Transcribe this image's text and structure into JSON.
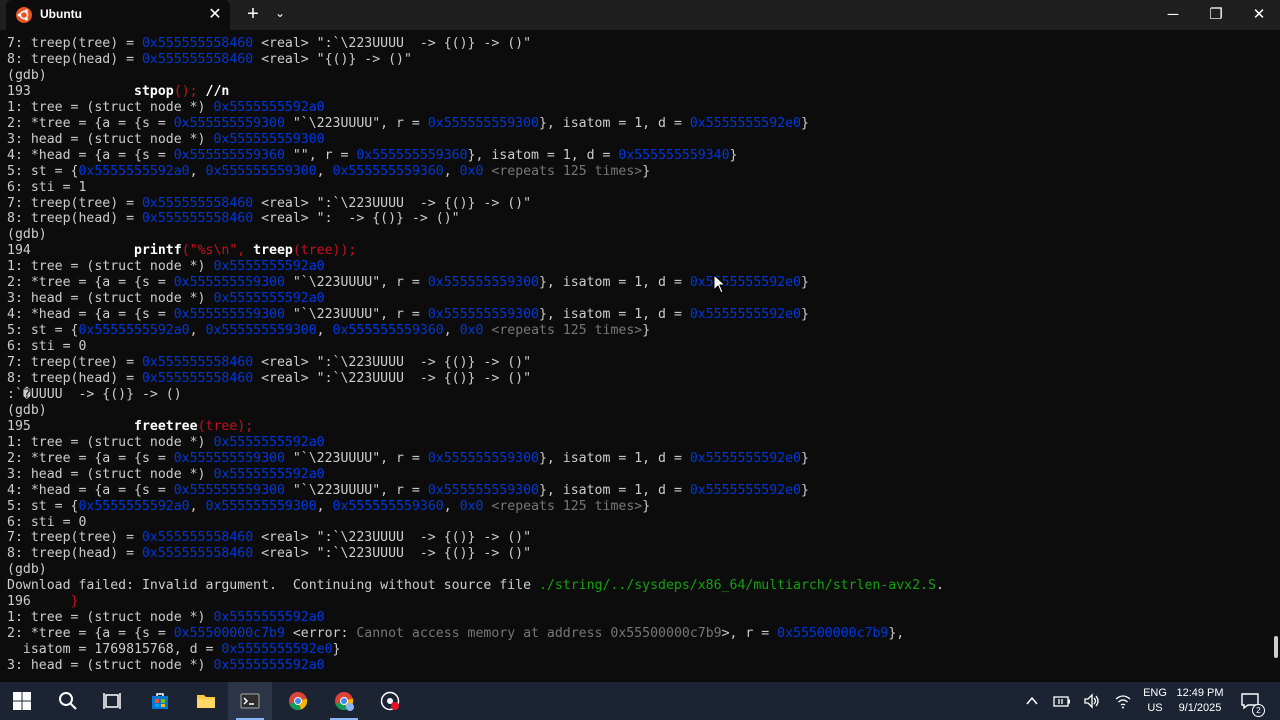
{
  "window": {
    "tab_title": "Ubuntu",
    "tab_close": "✕",
    "new_tab": "+",
    "dropdown": "⌄",
    "minimize": "─",
    "maximize": "❐",
    "close": "✕"
  },
  "terminal": {
    "lines": [
      [
        {
          "t": "7: treep(tree) = "
        },
        {
          "t": "0x555555558460",
          "c": "addr"
        },
        {
          "t": " <real> \":`\\223UUUU  -> {()} -> ()\""
        }
      ],
      [
        {
          "t": "8: treep(head) = "
        },
        {
          "t": "0x555555558460",
          "c": "addr"
        },
        {
          "t": " <real> \"{()} -> ()\""
        }
      ],
      [
        {
          "t": "(gdb)"
        }
      ],
      [
        {
          "t": "193             "
        },
        {
          "t": "stpop",
          "c": "b"
        },
        {
          "t": "();",
          "c": "str"
        },
        {
          "t": " //n",
          "c": "b"
        }
      ],
      [
        {
          "t": "1: tree = (struct node *) "
        },
        {
          "t": "0x5555555592a0",
          "c": "addr"
        }
      ],
      [
        {
          "t": "2: *tree = {a = {s = "
        },
        {
          "t": "0x555555559300",
          "c": "addr"
        },
        {
          "t": " \"`\\223UUUU\", r = "
        },
        {
          "t": "0x555555559300",
          "c": "addr"
        },
        {
          "t": "}, isatom = 1, d = "
        },
        {
          "t": "0x5555555592e0",
          "c": "addr"
        },
        {
          "t": "}"
        }
      ],
      [
        {
          "t": "3: head = (struct node *) "
        },
        {
          "t": "0x555555559300",
          "c": "addr"
        }
      ],
      [
        {
          "t": "4: *head = {a = {s = "
        },
        {
          "t": "0x555555559360",
          "c": "addr"
        },
        {
          "t": " \"\", r = "
        },
        {
          "t": "0x555555559360",
          "c": "addr"
        },
        {
          "t": "}, isatom = 1, d = "
        },
        {
          "t": "0x555555559340",
          "c": "addr"
        },
        {
          "t": "}"
        }
      ],
      [
        {
          "t": "5: st = {"
        },
        {
          "t": "0x5555555592a0",
          "c": "addr"
        },
        {
          "t": ", "
        },
        {
          "t": "0x555555559300",
          "c": "addr"
        },
        {
          "t": ", "
        },
        {
          "t": "0x555555559360",
          "c": "addr"
        },
        {
          "t": ", "
        },
        {
          "t": "0x0",
          "c": "addr"
        },
        {
          "t": " <repeats 125 times>",
          "c": "gr"
        },
        {
          "t": "}"
        }
      ],
      [
        {
          "t": "6: sti = 1"
        }
      ],
      [
        {
          "t": "7: treep(tree) = "
        },
        {
          "t": "0x555555558460",
          "c": "addr"
        },
        {
          "t": " <real> \":`\\223UUUU  -> {()} -> ()\""
        }
      ],
      [
        {
          "t": "8: treep(head) = "
        },
        {
          "t": "0x555555558460",
          "c": "addr"
        },
        {
          "t": " <real> \":  -> {()} -> ()\""
        }
      ],
      [
        {
          "t": "(gdb)"
        }
      ],
      [
        {
          "t": "194             "
        },
        {
          "t": "printf",
          "c": "b"
        },
        {
          "t": "(\"%s\\n\", ",
          "c": "str"
        },
        {
          "t": "treep",
          "c": "b"
        },
        {
          "t": "(tree));",
          "c": "str"
        }
      ],
      [
        {
          "t": "1: tree = (struct node *) "
        },
        {
          "t": "0x5555555592a0",
          "c": "addr"
        }
      ],
      [
        {
          "t": "2: *tree = {a = {s = "
        },
        {
          "t": "0x555555559300",
          "c": "addr"
        },
        {
          "t": " \"`\\223UUUU\", r = "
        },
        {
          "t": "0x555555559300",
          "c": "addr"
        },
        {
          "t": "}, isatom = 1, d = "
        },
        {
          "t": "0x5555555592e0",
          "c": "addr"
        },
        {
          "t": "}"
        }
      ],
      [
        {
          "t": "3: head = (struct node *) "
        },
        {
          "t": "0x5555555592a0",
          "c": "addr"
        }
      ],
      [
        {
          "t": "4: *head = {a = {s = "
        },
        {
          "t": "0x555555559300",
          "c": "addr"
        },
        {
          "t": " \"`\\223UUUU\", r = "
        },
        {
          "t": "0x555555559300",
          "c": "addr"
        },
        {
          "t": "}, isatom = 1, d = "
        },
        {
          "t": "0x5555555592e0",
          "c": "addr"
        },
        {
          "t": "}"
        }
      ],
      [
        {
          "t": "5: st = {"
        },
        {
          "t": "0x5555555592a0",
          "c": "addr"
        },
        {
          "t": ", "
        },
        {
          "t": "0x555555559300",
          "c": "addr"
        },
        {
          "t": ", "
        },
        {
          "t": "0x555555559360",
          "c": "addr"
        },
        {
          "t": ", "
        },
        {
          "t": "0x0",
          "c": "addr"
        },
        {
          "t": " <repeats 125 times>",
          "c": "gr"
        },
        {
          "t": "}"
        }
      ],
      [
        {
          "t": "6: sti = 0"
        }
      ],
      [
        {
          "t": "7: treep(tree) = "
        },
        {
          "t": "0x555555558460",
          "c": "addr"
        },
        {
          "t": " <real> \":`\\223UUUU  -> {()} -> ()\""
        }
      ],
      [
        {
          "t": "8: treep(head) = "
        },
        {
          "t": "0x555555558460",
          "c": "addr"
        },
        {
          "t": " <real> \":`\\223UUUU  -> {()} -> ()\""
        }
      ],
      [
        {
          "t": ":`�UUUU  -> {()} -> ()"
        }
      ],
      [
        {
          "t": "(gdb)"
        }
      ],
      [
        {
          "t": "195             "
        },
        {
          "t": "freetree",
          "c": "b"
        },
        {
          "t": "(tree);",
          "c": "str"
        }
      ],
      [
        {
          "t": "1: tree = (struct node *) "
        },
        {
          "t": "0x5555555592a0",
          "c": "addr"
        }
      ],
      [
        {
          "t": "2: *tree = {a = {s = "
        },
        {
          "t": "0x555555559300",
          "c": "addr"
        },
        {
          "t": " \"`\\223UUUU\", r = "
        },
        {
          "t": "0x555555559300",
          "c": "addr"
        },
        {
          "t": "}, isatom = 1, d = "
        },
        {
          "t": "0x5555555592e0",
          "c": "addr"
        },
        {
          "t": "}"
        }
      ],
      [
        {
          "t": "3: head = (struct node *) "
        },
        {
          "t": "0x5555555592a0",
          "c": "addr"
        }
      ],
      [
        {
          "t": "4: *head = {a = {s = "
        },
        {
          "t": "0x555555559300",
          "c": "addr"
        },
        {
          "t": " \"`\\223UUUU\", r = "
        },
        {
          "t": "0x555555559300",
          "c": "addr"
        },
        {
          "t": "}, isatom = 1, d = "
        },
        {
          "t": "0x5555555592e0",
          "c": "addr"
        },
        {
          "t": "}"
        }
      ],
      [
        {
          "t": "5: st = {"
        },
        {
          "t": "0x5555555592a0",
          "c": "addr"
        },
        {
          "t": ", "
        },
        {
          "t": "0x555555559300",
          "c": "addr"
        },
        {
          "t": ", "
        },
        {
          "t": "0x555555559360",
          "c": "addr"
        },
        {
          "t": ", "
        },
        {
          "t": "0x0",
          "c": "addr"
        },
        {
          "t": " <repeats 125 times>",
          "c": "gr"
        },
        {
          "t": "}"
        }
      ],
      [
        {
          "t": "6: sti = 0"
        }
      ],
      [
        {
          "t": "7: treep(tree) = "
        },
        {
          "t": "0x555555558460",
          "c": "addr"
        },
        {
          "t": " <real> \":`\\223UUUU  -> {()} -> ()\""
        }
      ],
      [
        {
          "t": "8: treep(head) = "
        },
        {
          "t": "0x555555558460",
          "c": "addr"
        },
        {
          "t": " <real> \":`\\223UUUU  -> {()} -> ()\""
        }
      ],
      [
        {
          "t": "(gdb)"
        }
      ],
      [
        {
          "t": "Download failed: Invalid argument.  Continuing without source file "
        },
        {
          "t": "./string/../sysdeps/x86_64/multiarch/strlen-avx2.S",
          "c": "grn"
        },
        {
          "t": "."
        }
      ],
      [
        {
          "t": "196     "
        },
        {
          "t": "}",
          "c": "str"
        }
      ],
      [
        {
          "t": "1: tree = (struct node *) "
        },
        {
          "t": "0x5555555592a0",
          "c": "addr"
        }
      ],
      [
        {
          "t": "2: *tree = {a = {s = "
        },
        {
          "t": "0x55500000c7b9",
          "c": "addr"
        },
        {
          "t": " <error: "
        },
        {
          "t": "Cannot access memory at address 0x55500000c7b9",
          "c": "gr"
        },
        {
          "t": ">, r = "
        },
        {
          "t": "0x55500000c7b9",
          "c": "addr"
        },
        {
          "t": "},"
        }
      ],
      [
        {
          "t": "  isatom = 1769815768, d = "
        },
        {
          "t": "0x5555555592e0",
          "c": "addr"
        },
        {
          "t": "}"
        }
      ],
      [
        {
          "t": "3: head = (struct node *) "
        },
        {
          "t": "0x5555555592a0",
          "c": "addr"
        }
      ]
    ]
  },
  "taskbar": {
    "lang_top": "ENG",
    "lang_bottom": "US",
    "time": "12:49 PM",
    "date": "9/1/2025",
    "notification_count": "2"
  },
  "colors": {
    "terminal_bg": "#0c0c0c",
    "text": "#cccccc",
    "address": "#0037da",
    "string": "#c50f1f",
    "comment_gray": "#767676",
    "path_green": "#13a10e",
    "taskbar_bg": "#1c2434"
  }
}
